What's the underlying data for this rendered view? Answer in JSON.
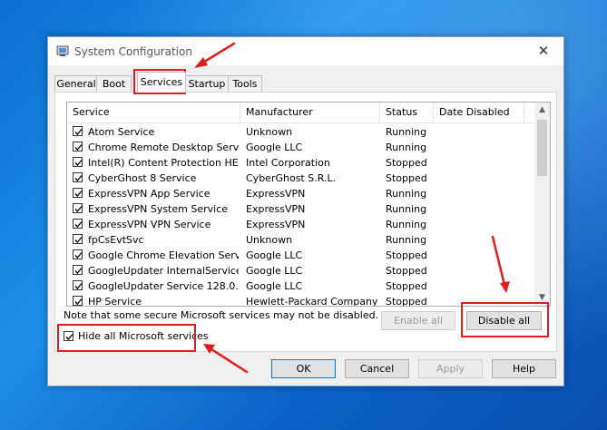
{
  "window": {
    "title": "System Configuration",
    "close_glyph": "✕"
  },
  "tabs": [
    {
      "label": "General",
      "active": false
    },
    {
      "label": "Boot",
      "active": false
    },
    {
      "label": "Services",
      "active": true
    },
    {
      "label": "Startup",
      "active": false
    },
    {
      "label": "Tools",
      "active": false
    }
  ],
  "services": {
    "columns": [
      "Service",
      "Manufacturer",
      "Status",
      "Date Disabled"
    ],
    "rows": [
      {
        "name": "Atom Service",
        "manufacturer": "Unknown",
        "status": "Running",
        "date_disabled": "",
        "checked": true
      },
      {
        "name": "Chrome Remote Desktop Service",
        "manufacturer": "Google LLC",
        "status": "Running",
        "date_disabled": "",
        "checked": true
      },
      {
        "name": "Intel(R) Content Protection HEC...",
        "manufacturer": "Intel Corporation",
        "status": "Stopped",
        "date_disabled": "",
        "checked": true
      },
      {
        "name": "CyberGhost 8 Service",
        "manufacturer": "CyberGhost S.R.L.",
        "status": "Stopped",
        "date_disabled": "",
        "checked": true
      },
      {
        "name": "ExpressVPN App Service",
        "manufacturer": "ExpressVPN",
        "status": "Running",
        "date_disabled": "",
        "checked": true
      },
      {
        "name": "ExpressVPN System Service",
        "manufacturer": "ExpressVPN",
        "status": "Running",
        "date_disabled": "",
        "checked": true
      },
      {
        "name": "ExpressVPN VPN Service",
        "manufacturer": "ExpressVPN",
        "status": "Running",
        "date_disabled": "",
        "checked": true
      },
      {
        "name": "fpCsEvtSvc",
        "manufacturer": "Unknown",
        "status": "Running",
        "date_disabled": "",
        "checked": true
      },
      {
        "name": "Google Chrome Elevation Servic...",
        "manufacturer": "Google LLC",
        "status": "Stopped",
        "date_disabled": "",
        "checked": true
      },
      {
        "name": "GoogleUpdater InternalService ...",
        "manufacturer": "Google LLC",
        "status": "Stopped",
        "date_disabled": "",
        "checked": true
      },
      {
        "name": "GoogleUpdater Service 128.0.6...",
        "manufacturer": "Google LLC",
        "status": "Stopped",
        "date_disabled": "",
        "checked": true
      },
      {
        "name": "HP Service",
        "manufacturer": "Hewlett-Packard Company",
        "status": "Stopped",
        "date_disabled": "",
        "checked": true
      }
    ]
  },
  "note": "Note that some secure Microsoft services may not be disabled.",
  "buttons": {
    "enable_all": "Enable all",
    "disable_all": "Disable all",
    "ok": "OK",
    "cancel": "Cancel",
    "apply": "Apply",
    "help": "Help"
  },
  "hide_microsoft": {
    "label": "Hide all Microsoft services",
    "checked": true
  },
  "colors": {
    "highlight": "#e01c1c",
    "accent": "#0078d7"
  }
}
